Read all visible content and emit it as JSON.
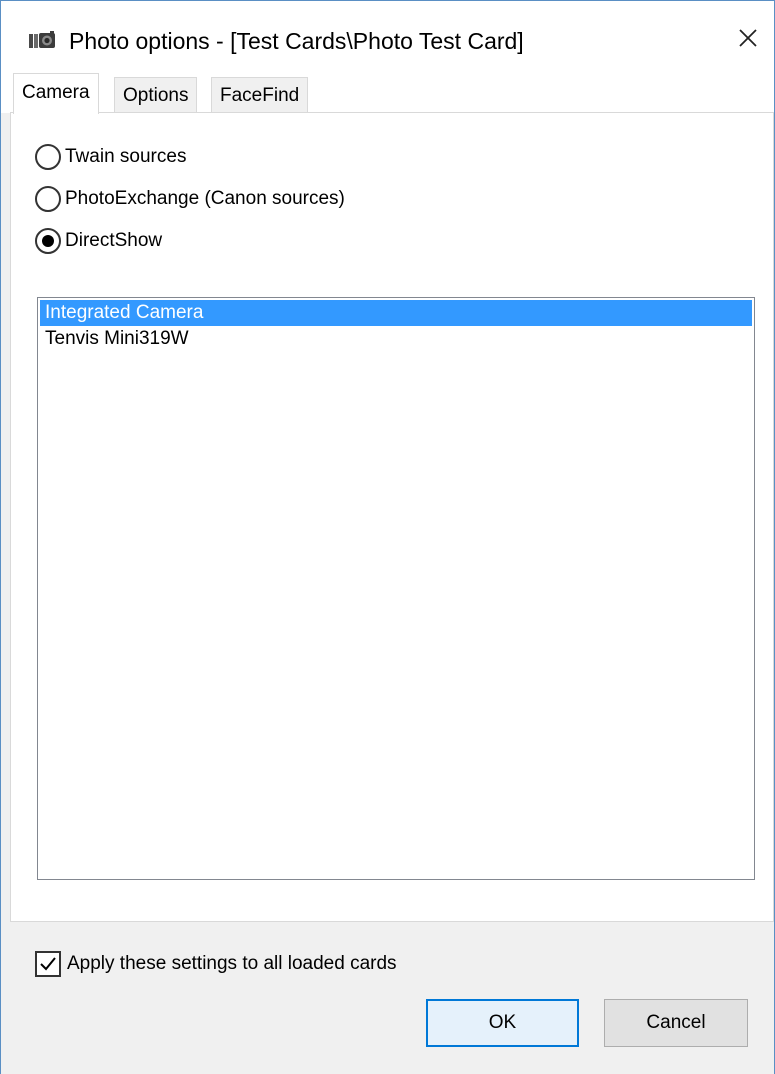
{
  "window": {
    "title": "Photo options - [Test Cards\\Photo Test Card]"
  },
  "tabs": [
    {
      "label": "Camera",
      "active": true
    },
    {
      "label": "Options",
      "active": false
    },
    {
      "label": "FaceFind",
      "active": false
    }
  ],
  "camera": {
    "sources": [
      {
        "label": "Twain sources",
        "selected": false
      },
      {
        "label": "PhotoExchange (Canon sources)",
        "selected": false
      },
      {
        "label": "DirectShow",
        "selected": true
      }
    ],
    "devices": [
      {
        "label": "Integrated Camera",
        "selected": true
      },
      {
        "label": "Tenvis Mini319W",
        "selected": false
      }
    ]
  },
  "apply_all": {
    "label": "Apply these settings to all loaded cards",
    "checked": true
  },
  "buttons": {
    "ok": "OK",
    "cancel": "Cancel"
  },
  "colors": {
    "selection": "#3399ff",
    "window_border": "#5a8fc4",
    "default_button_border": "#0078d7"
  },
  "icons": {
    "app": "camera-app-icon",
    "close": "close-icon"
  }
}
